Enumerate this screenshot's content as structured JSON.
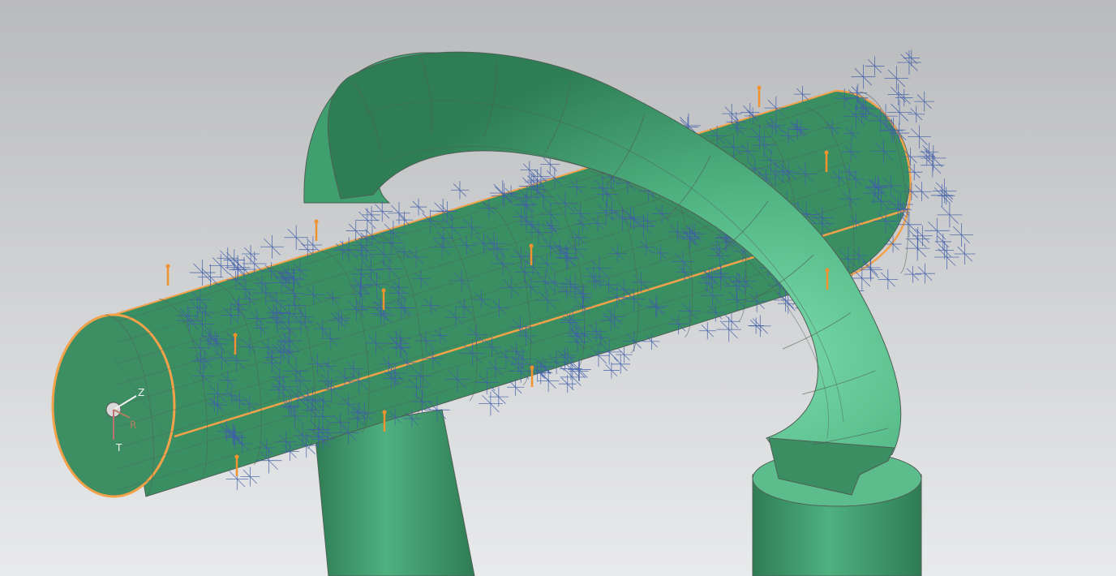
{
  "viewport": {
    "background_top": "#b9babc",
    "background_bottom": "#e9eaec"
  },
  "model": {
    "surface_color": "#3e9a6c",
    "surface_light": "#72d4a2",
    "surface_dark": "#2a6e4c",
    "mesh_line_color": "#4f5f56",
    "edge_highlight_color": "#f3a24a",
    "load_arrow_color": "#3f5ea8",
    "constraint_marker_color": "#f0922e"
  },
  "csys": {
    "labels": {
      "z": "Z",
      "r": "R",
      "t": "T"
    },
    "label_color": "#f2f2f2",
    "r_color": "#b08060"
  }
}
